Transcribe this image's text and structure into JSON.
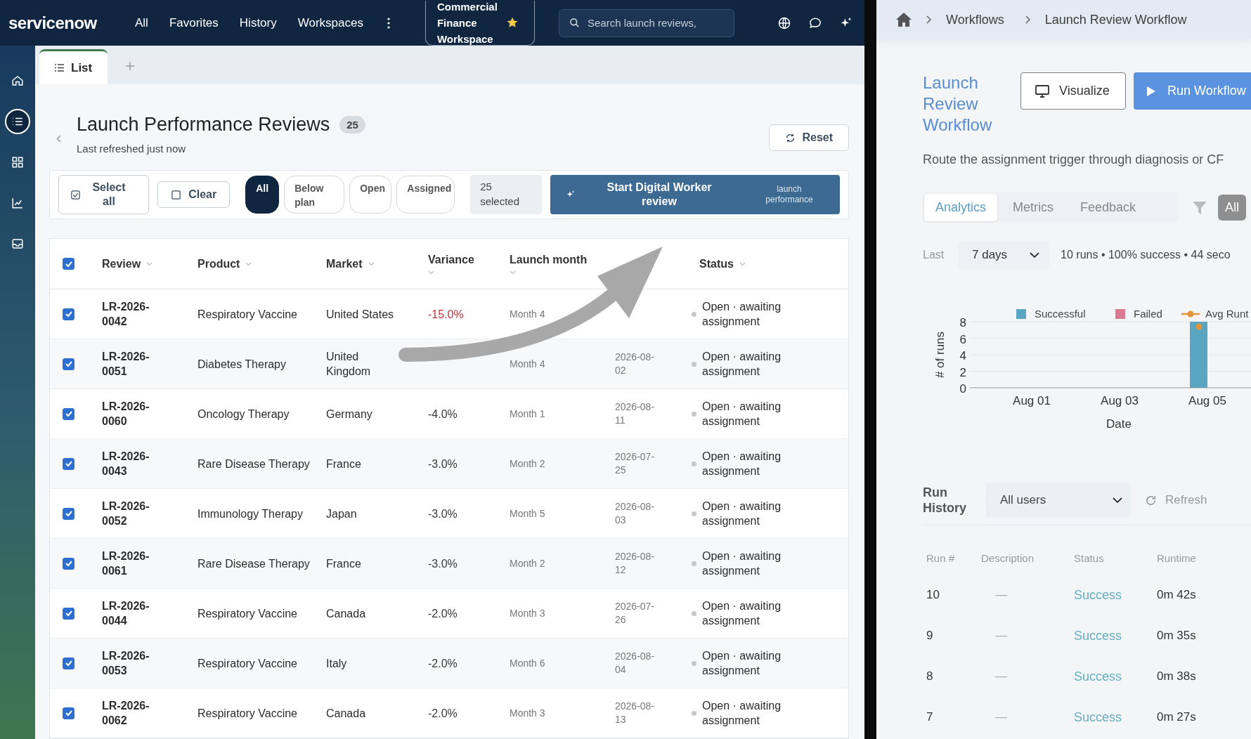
{
  "topbar": {
    "logo": "servicenow",
    "nav": [
      "All",
      "Favorites",
      "History",
      "Workspaces"
    ],
    "workspace": "Commercial Finance Workspace",
    "search": {
      "placeholder": "Search launch reviews,"
    }
  },
  "rail": [
    {
      "selected": false
    },
    {
      "selected": true
    },
    {
      "selected": false
    },
    {
      "selected": false
    },
    {
      "selected": false
    }
  ],
  "tabs": [
    {
      "label": "List",
      "selected": true
    }
  ],
  "page": {
    "title": "Launch Performance Reviews",
    "count": "25",
    "subtitle": "Last refreshed just now",
    "reset": "Reset"
  },
  "toolbar": {
    "select_all": "Select all",
    "clear": "Clear",
    "selected_count": "25 selected",
    "action": "Start Digital Worker review",
    "action_note": "launch performance"
  },
  "filters": [
    {
      "label": "All",
      "selected": true
    },
    {
      "label": "Below plan",
      "selected": false
    },
    {
      "label": "Open",
      "selected": false
    },
    {
      "label": "Assigned",
      "selected": false
    }
  ],
  "table": {
    "all_checked": true,
    "columns": [
      "Review",
      "Product",
      "Market",
      "Variance",
      "Launch month",
      "Status"
    ],
    "rows": [
      {
        "checked": true,
        "review": "LR-2026-0042",
        "product": "Respiratory Vaccine",
        "market": "United States",
        "variance": "-15.0%",
        "color": "#b8383d",
        "month": "Month 4",
        "status": "Open · awaiting assignment"
      },
      {
        "checked": true,
        "review": "LR-2026-0051",
        "product": "Diabetes Therapy",
        "market": "United Kingdom",
        "month": "Month 4",
        "date": "2026-08-02",
        "status": "Open · awaiting assignment"
      },
      {
        "checked": true,
        "review": "LR-2026-0060",
        "product": "Oncology Therapy",
        "market": "Germany",
        "variance": "-4.0%",
        "color": "#3a3a3a",
        "month": "Month 1",
        "date": "2026-08-11",
        "status": "Open · awaiting assignment"
      },
      {
        "checked": true,
        "review": "LR-2026-0043",
        "product": "Rare Disease Therapy",
        "market": "France",
        "variance": "-3.0%",
        "color": "#3a3a3a",
        "month": "Month 2",
        "date": "2026-07-25",
        "status": "Open · awaiting assignment"
      },
      {
        "checked": true,
        "review": "LR-2026-0052",
        "product": "Immunology Therapy",
        "market": "Japan",
        "variance": "-3.0%",
        "color": "#3a3a3a",
        "month": "Month 5",
        "date": "2026-08-03",
        "status": "Open · awaiting assignment"
      },
      {
        "checked": true,
        "review": "LR-2026-0061",
        "product": "Rare Disease Therapy",
        "market": "France",
        "variance": "-3.0%",
        "color": "#3a3a3a",
        "month": "Month 2",
        "date": "2026-08-12",
        "status": "Open · awaiting assignment"
      },
      {
        "checked": true,
        "review": "LR-2026-0044",
        "product": "Respiratory Vaccine",
        "market": "Canada",
        "variance": "-2.0%",
        "color": "#3a3a3a",
        "month": "Month 3",
        "date": "2026-07-26",
        "status": "Open · awaiting assignment"
      },
      {
        "checked": true,
        "review": "LR-2026-0053",
        "product": "Respiratory Vaccine",
        "market": "Italy",
        "variance": "-2.0%",
        "color": "#3a3a3a",
        "month": "Month 6",
        "date": "2026-08-04",
        "status": "Open · awaiting assignment"
      },
      {
        "checked": true,
        "review": "LR-2026-0062",
        "product": "Respiratory Vaccine",
        "market": "Canada",
        "variance": "-2.0%",
        "color": "#3a3a3a",
        "month": "Month 3",
        "date": "2026-08-13",
        "status": "Open · awaiting assignment"
      }
    ]
  },
  "workflow": {
    "breadcrumb": [
      "Workflows",
      "Launch Review Workflow"
    ],
    "title": "Launch Review Workflow",
    "visualize": "Visualize",
    "run": "Run Workflow",
    "description": "Route the assignment trigger through diagnosis or CF",
    "tabs": [
      {
        "label": "Analytics",
        "selected": true
      },
      {
        "label": "Metrics",
        "selected": false
      },
      {
        "label": "Feedback",
        "selected": false
      }
    ],
    "scope": {
      "label": "All",
      "selected": true
    },
    "period_label": "Last",
    "period": "7 days",
    "summary": "10 runs • 100% success • 44 seco",
    "chart_data": {
      "type": "bar",
      "xlabel": "Date",
      "ylabel": "# of runs",
      "categories": [
        "Aug 01",
        "Aug 03",
        "Aug 05"
      ],
      "yticks": [
        0,
        2,
        4,
        6,
        8
      ],
      "ylim": [
        0,
        8
      ],
      "grid": true,
      "legend": true,
      "series": [
        {
          "name": "Successful",
          "color": "#5aa6c2",
          "values": [
            0,
            0,
            8
          ]
        },
        {
          "name": "Failed",
          "color": "#d97b94",
          "values": [
            0,
            0,
            0
          ]
        },
        {
          "name": "Avg Runt",
          "color": "#e0953a",
          "type": "line",
          "marker": true,
          "values": [
            null,
            null,
            7.4
          ]
        }
      ]
    },
    "history": {
      "title": "Run History",
      "filter": "All users",
      "refresh": "Refresh",
      "columns": [
        "Run #",
        "Description",
        "Status",
        "Runtime"
      ],
      "rows": [
        {
          "run": "10",
          "description": "—",
          "status": "Success",
          "runtime": "0m 42s"
        },
        {
          "run": "9",
          "description": "—",
          "status": "Success",
          "runtime": "0m 35s"
        },
        {
          "run": "8",
          "description": "—",
          "status": "Success",
          "runtime": "0m 38s"
        },
        {
          "run": "7",
          "description": "—",
          "status": "Success",
          "runtime": "0m 27s"
        }
      ]
    }
  }
}
